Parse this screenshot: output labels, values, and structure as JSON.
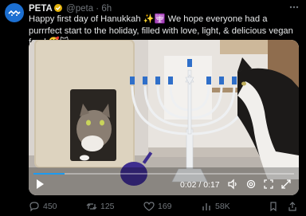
{
  "post": {
    "author_name": "PETA",
    "handle": "@peta",
    "separator": "·",
    "time": "6h",
    "text": "Happy first day of Hanukkah ✨🕎 We hope everyone had a purrrfect start to the holiday, filled with love, light, & delicious vegan food 🥰🐱"
  },
  "video": {
    "timecode": "0:02 / 0:17",
    "progress_fraction": 0.12
  },
  "actions": {
    "replies": "450",
    "reposts": "125",
    "likes": "169",
    "views": "58K"
  },
  "colors": {
    "accent": "#1d9bf0",
    "verified": "#e3b20b",
    "avatar_bg": "#1c6fd1",
    "muted": "#71767b"
  },
  "icons": [
    "peta-logo-icon",
    "verified-badge-icon",
    "more-icon",
    "play-icon",
    "volume-icon",
    "settings-icon",
    "fullscreen-icon",
    "expand-icon",
    "reply-icon",
    "repost-icon",
    "like-icon",
    "views-icon",
    "bookmark-icon",
    "share-icon"
  ]
}
